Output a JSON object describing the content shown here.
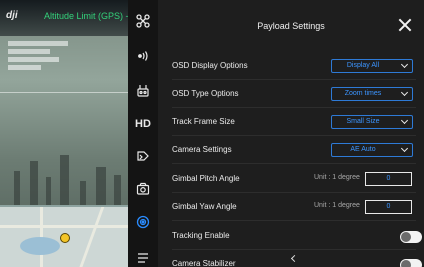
{
  "feed": {
    "logo": "dji",
    "status": "Altitude Limit (GPS) - M"
  },
  "rail": {
    "items": [
      {
        "name": "drone-icon"
      },
      {
        "name": "signal-icon"
      },
      {
        "name": "remote-controller-icon"
      },
      {
        "label": "HD"
      },
      {
        "name": "payload-icon"
      },
      {
        "name": "camera-icon"
      },
      {
        "name": "target-icon"
      },
      {
        "name": "more-icon"
      }
    ]
  },
  "panel": {
    "title": "Payload Settings",
    "rows": {
      "osd_display": {
        "label": "OSD Display Options",
        "value": "Display All"
      },
      "osd_type": {
        "label": "OSD Type Options",
        "value": "Zoom times"
      },
      "track_frame": {
        "label": "Track Frame Size",
        "value": "Small Size"
      },
      "camera_settings": {
        "label": "Camera Settings",
        "value": "AE Auto"
      },
      "gimbal_pitch": {
        "label": "Gimbal Pitch Angle",
        "unit": "Unit : 1 degree",
        "value": "0"
      },
      "gimbal_yaw": {
        "label": "Gimbal Yaw  Angle",
        "unit": "Unit : 1 degree",
        "value": "0"
      },
      "tracking": {
        "label": "Tracking Enable",
        "on": false
      },
      "stabilizer": {
        "label": "Camera Stabilizer",
        "on": false
      }
    }
  },
  "colors": {
    "accent": "#2e7ad6",
    "accent_text": "#3c95ff",
    "status_text": "#33d17a",
    "panel_bg": "#1e1e1e"
  }
}
